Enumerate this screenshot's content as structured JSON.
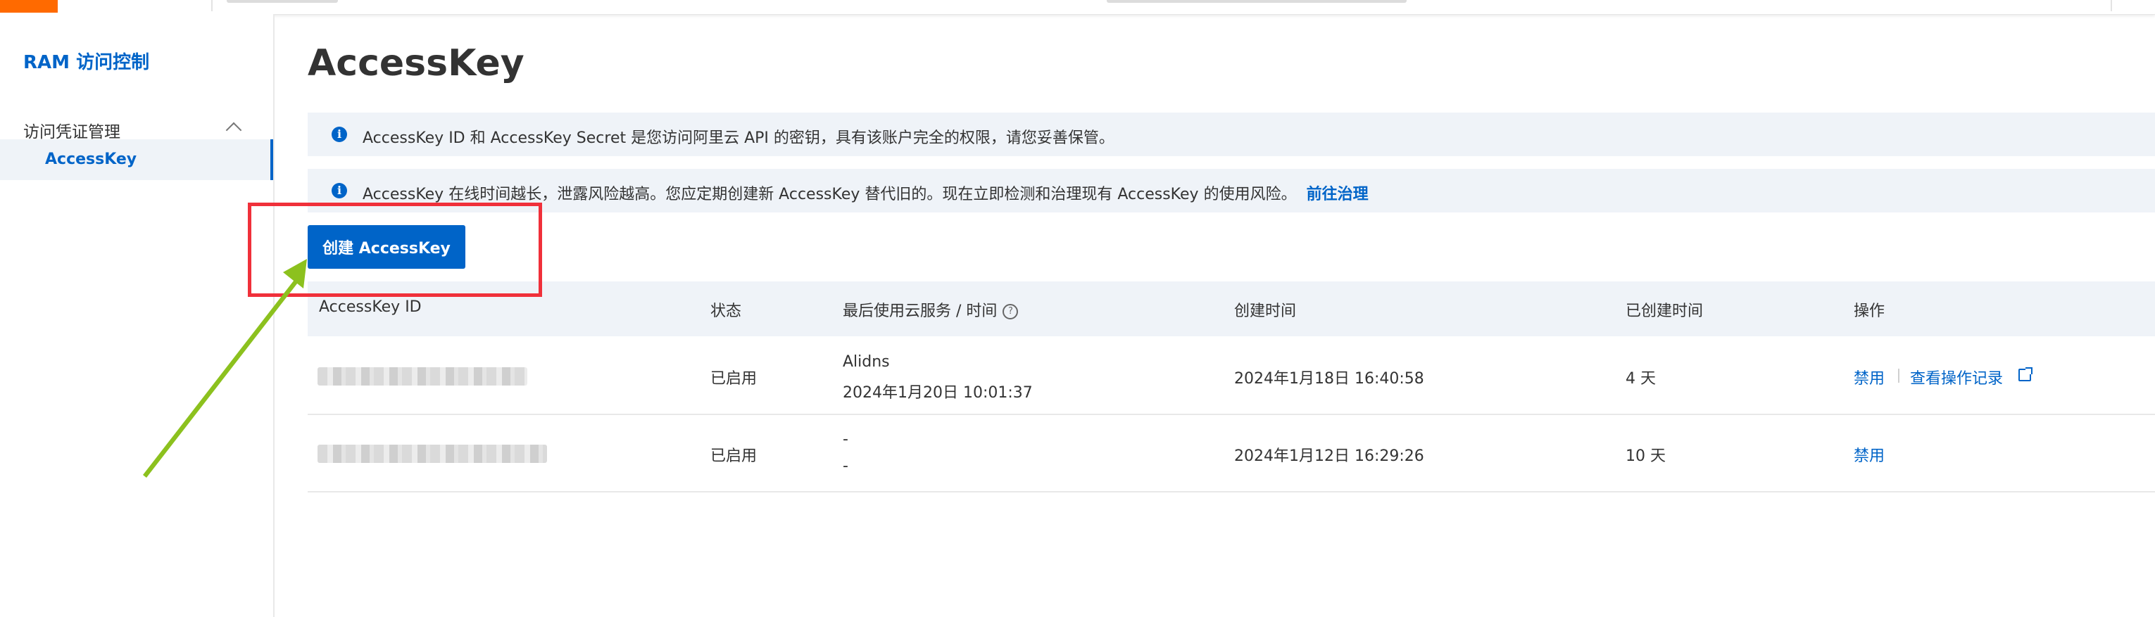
{
  "sidebar": {
    "title": "RAM 访问控制",
    "group_label": "访问凭证管理",
    "active_item": "AccessKey"
  },
  "main": {
    "title": "AccessKey",
    "notice_1": "AccessKey ID 和 AccessKey Secret 是您访问阿里云 API 的密钥，具有该账户完全的权限，请您妥善保管。",
    "notice_2": "AccessKey 在线时间越长，泄露风险越高。您应定期创建新 AccessKey 替代旧的。现在立即检测和治理现有 AccessKey 的使用风险。",
    "notice_2_link": "前往治理",
    "info_icon_glyph": "i",
    "create_button": "创建 AccessKey"
  },
  "table": {
    "columns": [
      "AccessKey ID",
      "状态",
      "最后使用云服务 / 时间",
      "创建时间",
      "已创建时间",
      "操作"
    ],
    "help_glyph": "?",
    "rows": [
      {
        "status": "已启用",
        "last_service": "Alidns",
        "last_time": "2024年1月20日 10:01:37",
        "created": "2024年1月18日 16:40:58",
        "age": "4 天",
        "action_disable": "禁用",
        "action_log": "查看操作记录"
      },
      {
        "status": "已启用",
        "last_service": "-",
        "last_time": "-",
        "created": "2024年1月12日 16:29:26",
        "age": "10 天",
        "action_disable": "禁用"
      }
    ]
  },
  "colors": {
    "brand_orange": "#ff6a00",
    "primary_blue": "#0064c8",
    "annotation_red": "#f0303a",
    "annotation_arrow": "#8cc11e",
    "notice_bg": "#eff3f8"
  },
  "icons": [
    "info-icon",
    "chevron-up-icon",
    "help-circle-icon",
    "external-link-icon",
    "annotation-arrow-icon"
  ]
}
